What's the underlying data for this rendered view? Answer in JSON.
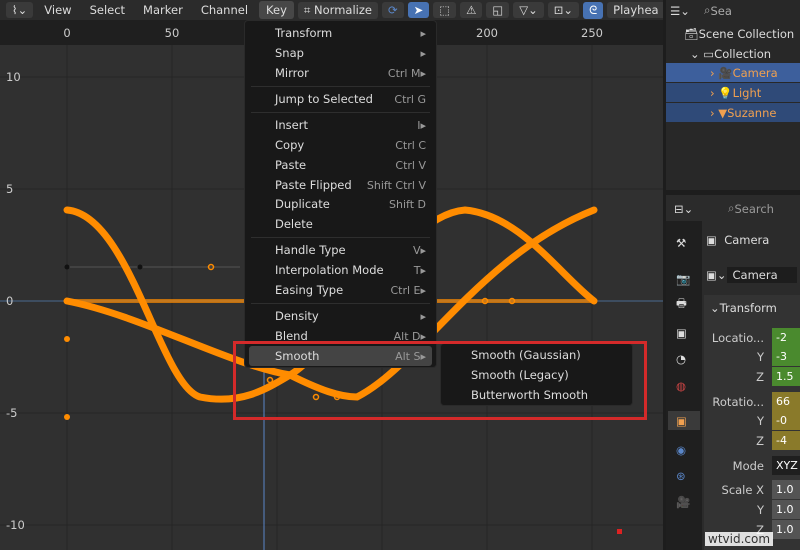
{
  "header": {
    "menus": [
      "View",
      "Select",
      "Marker",
      "Channel",
      "Key"
    ],
    "normalize": "Normalize",
    "playhead": "Playhea"
  },
  "ruler": {
    "frames": [
      "0",
      "50",
      "200",
      "250"
    ]
  },
  "yaxis": [
    "10",
    "5",
    "0",
    "-5",
    "-10"
  ],
  "key_menu": {
    "items": [
      {
        "label": "Transform",
        "shortcut": "▸"
      },
      {
        "label": "Snap",
        "shortcut": "▸"
      },
      {
        "label": "Mirror",
        "shortcut": "Ctrl M▸"
      },
      {
        "label": "Jump to Selected",
        "shortcut": "Ctrl G"
      },
      {
        "label": "Insert",
        "shortcut": "I▸"
      },
      {
        "label": "Copy",
        "shortcut": "Ctrl C"
      },
      {
        "label": "Paste",
        "shortcut": "Ctrl V"
      },
      {
        "label": "Paste Flipped",
        "shortcut": "Shift Ctrl V"
      },
      {
        "label": "Duplicate",
        "shortcut": "Shift D"
      },
      {
        "label": "Delete",
        "shortcut": ""
      },
      {
        "label": "Handle Type",
        "shortcut": "V▸"
      },
      {
        "label": "Interpolation Mode",
        "shortcut": "T▸"
      },
      {
        "label": "Easing Type",
        "shortcut": "Ctrl E▸"
      },
      {
        "label": "Density",
        "shortcut": "▸"
      },
      {
        "label": "Blend",
        "shortcut": "Alt D▸"
      },
      {
        "label": "Smooth",
        "shortcut": "Alt S▸"
      }
    ]
  },
  "smooth_submenu": [
    "Smooth (Gaussian)",
    "Smooth (Legacy)",
    "Butterworth Smooth"
  ],
  "outliner": {
    "search": "Sea",
    "scene_collection": "Scene Collection",
    "collection": "Collection",
    "objects": [
      "Camera",
      "Light",
      "Suzanne"
    ]
  },
  "properties": {
    "search": "Search",
    "object": "Camera",
    "data_name": "Camera",
    "panel": "Transform",
    "location": {
      "label": "Locatio...",
      "x": "-2",
      "y": "-3",
      "z": "1.5"
    },
    "rotation": {
      "label": "Rotatio...",
      "x": "66",
      "y": "-0",
      "z": "-4"
    },
    "mode": {
      "label": "Mode",
      "value": "XYZ"
    },
    "scale": {
      "label": "Scale X",
      "x": "1.0",
      "y": "1.0",
      "z": "1.0"
    },
    "axis": [
      "Y",
      "Z"
    ]
  },
  "watermark": "wtvid.com",
  "colors": {
    "curve": "#ff8c00",
    "highlight_box": "#d42a2a",
    "location": "#4a8a2e",
    "rotation": "#8a7a2a",
    "selected": "#3d5f9c"
  }
}
